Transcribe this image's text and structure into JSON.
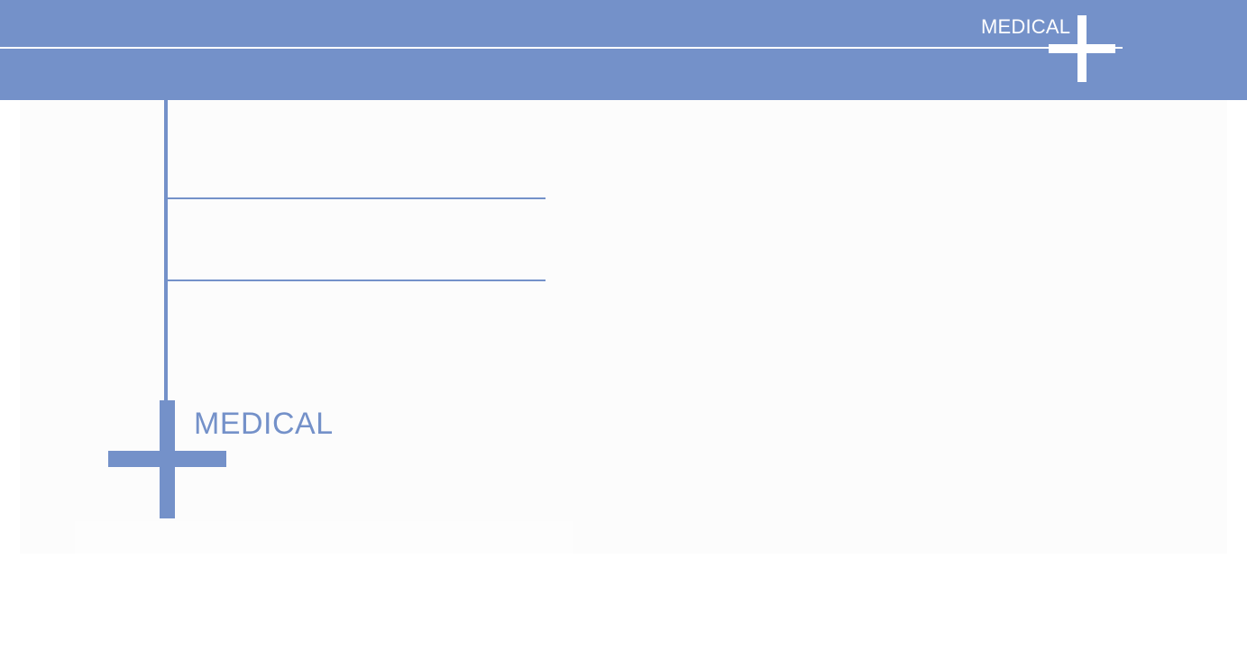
{
  "header": {
    "title": "MEDICAL"
  },
  "logo": {
    "title": "MEDICAL"
  },
  "colors": {
    "accent": "#7491c9",
    "background": "#ffffff",
    "panel": "#fcfcfc"
  },
  "icons": {
    "header": "cross-icon",
    "logo": "cross-icon"
  }
}
